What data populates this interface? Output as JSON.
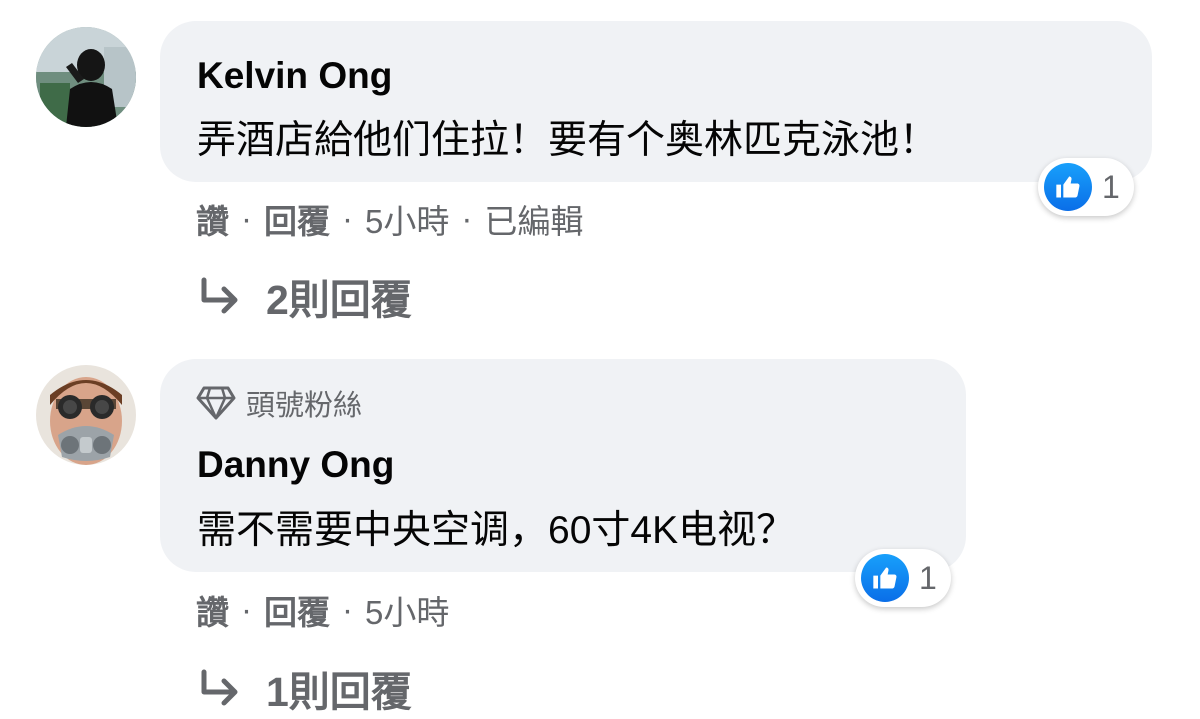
{
  "comments": [
    {
      "author": "Kelvin Ong",
      "text": "弄酒店給他们住拉！要有个奥林匹克泳池！",
      "reaction_count": "1",
      "actions": {
        "like": "讚",
        "reply": "回覆",
        "time": "5小時",
        "edited": "已編輯"
      },
      "replies_label": "2則回覆"
    },
    {
      "badge": "頭號粉絲",
      "author": "Danny Ong",
      "text": "需不需要中央空调，60寸4K电视？",
      "reaction_count": "1",
      "actions": {
        "like": "讚",
        "reply": "回覆",
        "time": "5小時"
      },
      "replies_label": "1則回覆"
    }
  ],
  "separator": "·",
  "colors": {
    "bubble_bg": "#f0f2f5",
    "secondary_text": "#65676b",
    "primary_text": "#050505",
    "like_blue": "#1877f2"
  }
}
